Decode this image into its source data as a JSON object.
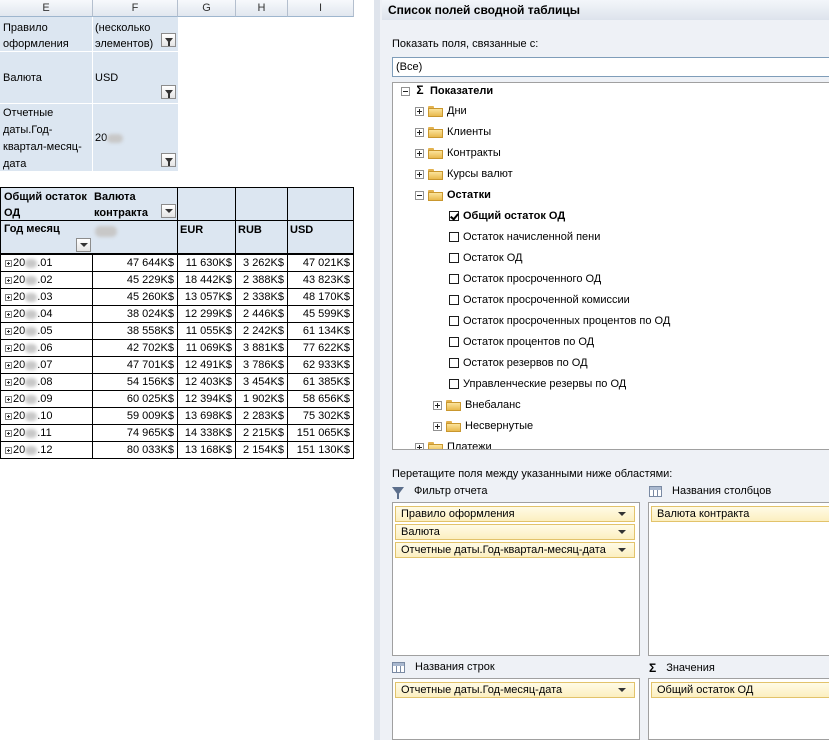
{
  "sheet": {
    "columns": [
      "E",
      "F",
      "G",
      "H",
      "I"
    ],
    "filters": [
      {
        "label": "Правило оформления",
        "value": "(несколько элементов)"
      },
      {
        "label": "Валюта",
        "value": "USD"
      },
      {
        "label": "Отчетные даты.Год-квартал-месяц-дата",
        "value": "20"
      }
    ],
    "pivot": {
      "corner_label": "Общий остаток ОД",
      "col_field": "Валюта контракта",
      "row_field": "Год месяц",
      "col_headers": [
        "",
        "EUR",
        "RUB",
        "USD"
      ],
      "rows": [
        {
          "label": "20",
          "suffix": ".01",
          "values": [
            "47 644K$",
            "11 630K$",
            "3 262K$",
            "47 021K$"
          ]
        },
        {
          "label": "20",
          "suffix": ".02",
          "values": [
            "45 229K$",
            "18 442K$",
            "2 388K$",
            "43 823K$"
          ]
        },
        {
          "label": "20",
          "suffix": ".03",
          "values": [
            "45 260K$",
            "13 057K$",
            "2 338K$",
            "48 170K$"
          ]
        },
        {
          "label": "20",
          "suffix": ".04",
          "values": [
            "38 024K$",
            "12 299K$",
            "2 446K$",
            "45 599K$"
          ]
        },
        {
          "label": "20",
          "suffix": ".05",
          "values": [
            "38 558K$",
            "11 055K$",
            "2 242K$",
            "61 134K$"
          ]
        },
        {
          "label": "20",
          "suffix": ".06",
          "values": [
            "42 702K$",
            "11 069K$",
            "3 881K$",
            "77 622K$"
          ]
        },
        {
          "label": "20",
          "suffix": ".07",
          "values": [
            "47 701K$",
            "12 491K$",
            "3 786K$",
            "62 933K$"
          ]
        },
        {
          "label": "20",
          "suffix": ".08",
          "values": [
            "54 156K$",
            "12 403K$",
            "3 454K$",
            "61 385K$"
          ]
        },
        {
          "label": "20",
          "suffix": ".09",
          "values": [
            "60 025K$",
            "12 394K$",
            "1 902K$",
            "58 656K$"
          ]
        },
        {
          "label": "20",
          "suffix": ".10",
          "values": [
            "59 009K$",
            "13 698K$",
            "2 283K$",
            "75 302K$"
          ]
        },
        {
          "label": "20",
          "suffix": ".11",
          "values": [
            "74 965K$",
            "14 338K$",
            "2 215K$",
            "151 065K$"
          ]
        },
        {
          "label": "20",
          "suffix": ".12",
          "values": [
            "80 033K$",
            "13 168K$",
            "2 154K$",
            "151 130K$"
          ]
        }
      ]
    }
  },
  "panel": {
    "title": "Список полей сводной таблицы",
    "show_fields_label": "Показать поля, связанные с:",
    "show_fields_value": "(Все)",
    "tree": [
      {
        "label": "Показатели",
        "kind": "sigma",
        "level": 0,
        "expanded": true,
        "bold": true
      },
      {
        "label": "Дни",
        "kind": "folder",
        "level": 1,
        "expanded": false
      },
      {
        "label": "Клиенты",
        "kind": "folder",
        "level": 1,
        "expanded": false
      },
      {
        "label": "Контракты",
        "kind": "folder",
        "level": 1,
        "expanded": false
      },
      {
        "label": "Курсы валют",
        "kind": "folder",
        "level": 1,
        "expanded": false
      },
      {
        "label": "Остатки",
        "kind": "folder",
        "level": 1,
        "expanded": true,
        "bold": true
      },
      {
        "label": "Общий остаток ОД",
        "kind": "check",
        "level": 2,
        "checked": true,
        "bold": true
      },
      {
        "label": "Остаток начисленной пени",
        "kind": "check",
        "level": 2,
        "checked": false
      },
      {
        "label": "Остаток ОД",
        "kind": "check",
        "level": 2,
        "checked": false
      },
      {
        "label": "Остаток просроченного ОД",
        "kind": "check",
        "level": 2,
        "checked": false
      },
      {
        "label": "Остаток просроченной комиссии",
        "kind": "check",
        "level": 2,
        "checked": false
      },
      {
        "label": "Остаток просроченных процентов по ОД",
        "kind": "check",
        "level": 2,
        "checked": false
      },
      {
        "label": "Остаток процентов по ОД",
        "kind": "check",
        "level": 2,
        "checked": false
      },
      {
        "label": "Остаток резервов по ОД",
        "kind": "check",
        "level": 2,
        "checked": false
      },
      {
        "label": "Управленческие резервы по ОД",
        "kind": "check",
        "level": 2,
        "checked": false
      },
      {
        "label": "Внебаланс",
        "kind": "folder",
        "level": 2,
        "expanded": false
      },
      {
        "label": "Несвернутые",
        "kind": "folder",
        "level": 2,
        "expanded": false
      },
      {
        "label": "Платежи",
        "kind": "folder",
        "level": 1,
        "expanded": false
      }
    ],
    "drag_label": "Перетащите поля между указанными ниже областями:",
    "areas": {
      "report_filter": {
        "title": "Фильтр отчета",
        "items": [
          "Правило оформления",
          "Валюта",
          "Отчетные даты.Год-квартал-месяц-дата"
        ]
      },
      "column_labels": {
        "title": "Названия столбцов",
        "items": [
          "Валюта контракта"
        ]
      },
      "row_labels": {
        "title": "Названия строк",
        "items": [
          "Отчетные даты.Год-месяц-дата"
        ]
      },
      "values": {
        "title": "Значения",
        "items": [
          "Общий остаток ОД"
        ]
      }
    }
  }
}
